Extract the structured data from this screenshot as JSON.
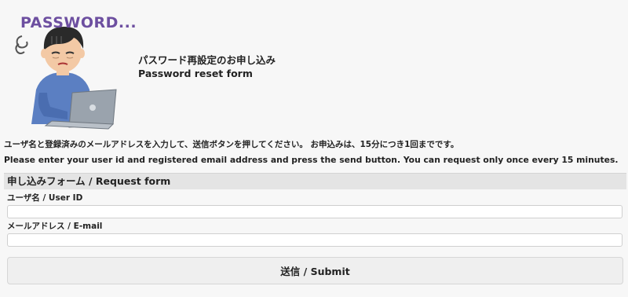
{
  "header": {
    "logo_text": "PASSWORD...",
    "title_ja": "パスワード再設定のお申し込み",
    "title_en": "Password reset form"
  },
  "notices": {
    "ja": "ユーザ名と登録済みのメールアドレスを入力して、送信ボタンを押してください。 お申込みは、15分につき1回までです。",
    "en": "Please enter your user id and registered email address and press the send button. You can request only once every 15 minutes."
  },
  "form": {
    "section_title": "申し込みフォーム / Request form",
    "userid_label": "ユーザ名 / User ID",
    "userid_value": "",
    "email_label": "メールアドレス / E-mail",
    "email_value": "",
    "submit_label": "送信 / Submit"
  },
  "colors": {
    "background": "#f7f7f7",
    "logo": "#6d4fa0",
    "section_header": "#e4e4e4",
    "button": "#efefef"
  },
  "icons": {
    "illustration": "tired-person-with-laptop-icon"
  }
}
